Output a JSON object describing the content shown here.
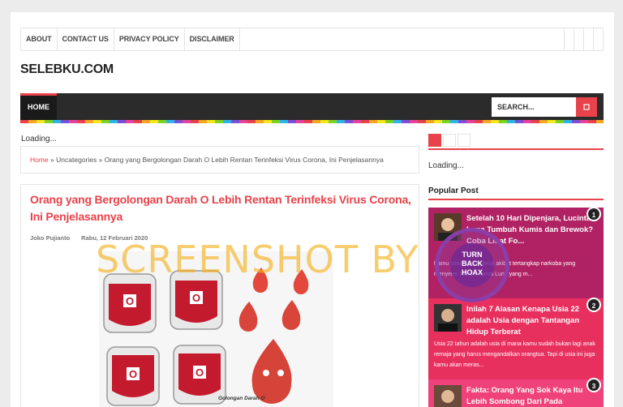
{
  "topnav": {
    "items": [
      "ABOUT",
      "CONTACT US",
      "PRIVACY POLICY",
      "DISCLAIMER"
    ]
  },
  "site": {
    "title": "SELEBKU.COM"
  },
  "mainnav": {
    "home": "HOME",
    "search_placeholder": "SEARCH..."
  },
  "page": {
    "loading": "Loading..."
  },
  "breadcrumb": {
    "home": "Home",
    "sep1": " » ",
    "category": "Uncategories",
    "sep2": " » ",
    "current": "Orang yang Bergolongan Darah O Lebih Rentan Terinfeksi Virus Corona, Ini Penjelasannya"
  },
  "post": {
    "title": "Orang yang Bergolongan Darah O Lebih Rentan Terinfeksi Virus Corona, Ini Penjelasannya",
    "author": "Joko Pujianto",
    "date": "Rabu, 12 Februari 2020",
    "image_caption": "Golongan Darah O",
    "bag_letter": "O"
  },
  "watermark": "SCREENSHOT BY",
  "badge": {
    "line1": "TURN",
    "line2": "BACK",
    "line3": "HOAX",
    "ring_text": "MAFINDO"
  },
  "sidebar": {
    "loading": "Loading...",
    "popular_title": "Popular Post",
    "posts": [
      {
        "num": "1",
        "title": "Setelah 10 Hari Dipenjara, Lucinta Luna Tumbuh Kumis dan Brewok? Coba Lihat Fo...",
        "snippet": "Kamu tidur di balik jeruji akibat tertangkap narkoba yang menyeret nama Lucinta Luna yang m..."
      },
      {
        "num": "2",
        "title": "Inilah 7 Alasan Kenapa Usia 22 adalah Usia dengan Tantangan Hidup Terberat",
        "snippet": "Usia 22 tahun adalah usia di mana kamu sudah bukan lagi anak remaja yang harus mengandalkan orangtua. Tapi di usia ini juga kamu akan meras..."
      },
      {
        "num": "3",
        "title": "Fakta: Orang Yang Sok Kaya Itu Lebih Sombong Dari Pada",
        "snippet": ""
      }
    ]
  },
  "colors": {
    "accent": "#e8424a",
    "nav_bg": "#2b2b2b",
    "pop1": "#b02263",
    "pop2": "#e8305f"
  }
}
